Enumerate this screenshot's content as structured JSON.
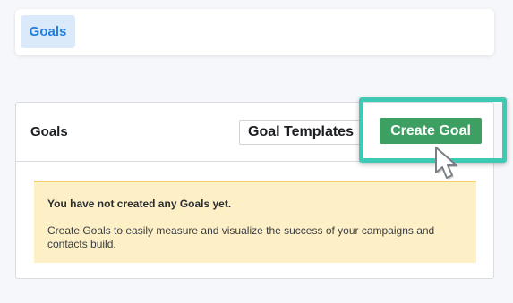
{
  "tabs": {
    "goals_label": "Goals"
  },
  "goals_panel": {
    "title": "Goals",
    "templates_button": "Goal Templates",
    "create_button": "Create Goal"
  },
  "notice": {
    "title": "You have not created any Goals yet.",
    "body": "Create Goals to easily measure and visualize the success of your campaigns and contacts build."
  },
  "colors": {
    "highlight": "#3ec9b4",
    "create_button": "#3e9f62",
    "tab_active_bg": "#dbeafb",
    "tab_active_text": "#1f7ee0",
    "notice_bg": "#fdf0c7"
  },
  "icons": {
    "cursor": "mouse-pointer-icon"
  }
}
